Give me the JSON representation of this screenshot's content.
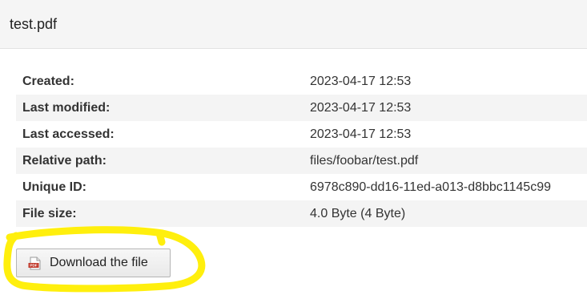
{
  "header": {
    "title": "test.pdf"
  },
  "details": [
    {
      "label": "Created:",
      "value": "2023-04-17 12:53"
    },
    {
      "label": "Last modified:",
      "value": "2023-04-17 12:53"
    },
    {
      "label": "Last accessed:",
      "value": "2023-04-17 12:53"
    },
    {
      "label": "Relative path:",
      "value": "files/foobar/test.pdf"
    },
    {
      "label": "Unique ID:",
      "value": "6978c890-dd16-11ed-a013-d8bbc1145c99"
    },
    {
      "label": "File size:",
      "value": "4.0 Byte (4 Byte)"
    }
  ],
  "download": {
    "label": "Download the file",
    "icon": "pdf-file-icon",
    "icon_text": "PDF"
  },
  "colors": {
    "highlight": "#ffee00",
    "header_bg": "#f5f5f5",
    "row_alt_bg": "#f4f4f4",
    "pdf_red": "#c0392b"
  }
}
